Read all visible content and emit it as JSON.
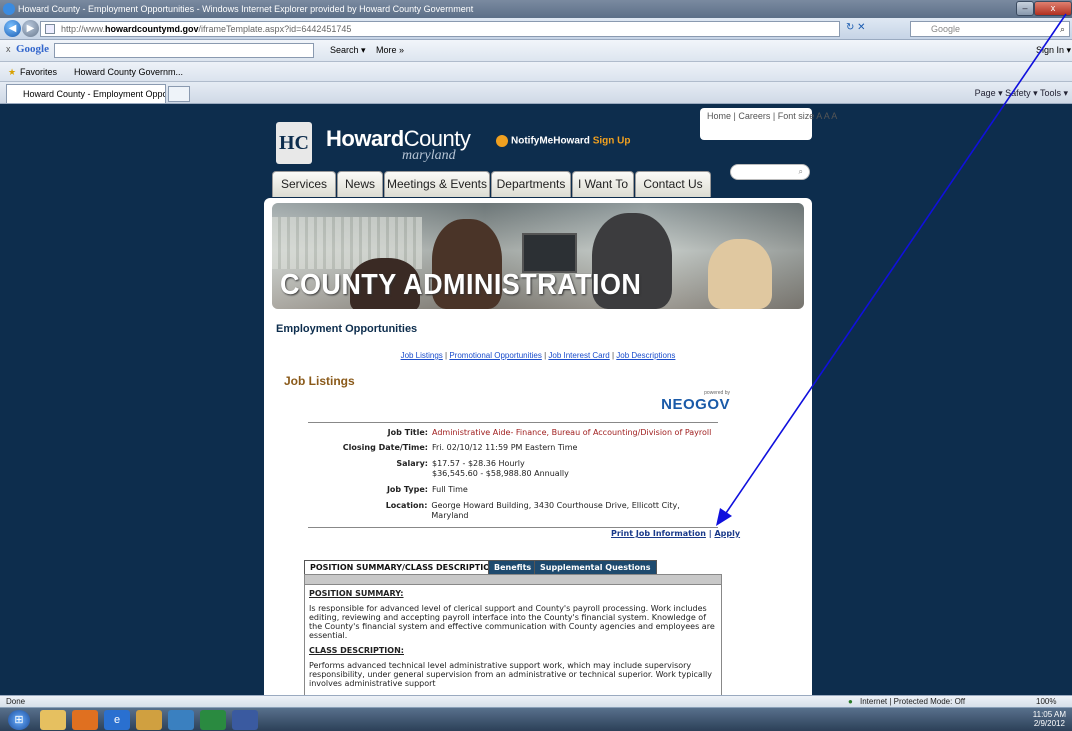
{
  "window": {
    "title": "Howard County - Employment Opportunities - Windows Internet Explorer provided by Howard County Government"
  },
  "address": {
    "url_prefix": "http://www.",
    "url_domain": "howardcountymd.gov",
    "url_path": "/iframeTemplate.aspx?id=6442451745",
    "search_placeholder": "Google"
  },
  "google_bar": {
    "x": "x",
    "logo": "Google",
    "search_label": "Search ▾",
    "more_label": "More »",
    "signin": "Sign In ▾"
  },
  "favorites": {
    "label": "Favorites",
    "item": "Howard County Governm..."
  },
  "ie_tab": {
    "label": "Howard County - Employment Opportunities"
  },
  "ie_tools": "Page ▾  Safety ▾  Tools ▾",
  "site": {
    "brand_bold": "Howard",
    "brand_rest": "County",
    "brand_sub": "maryland",
    "notify": "NotifyMeHoward",
    "signup": "Sign Up",
    "toplinks": "Home | Careers | Font size A A A",
    "nav": [
      "Services",
      "News",
      "Meetings & Events",
      "Departments",
      "I Want To",
      "Contact Us"
    ]
  },
  "banner": {
    "title": "COUNTY ADMINISTRATION"
  },
  "page": {
    "heading": "Employment Opportunities",
    "sublinks": [
      "Job Listings",
      "Promotional Opportunities",
      "Job Interest Card",
      "Job Descriptions"
    ],
    "listing_heading": "Job Listings",
    "powered_by": "powered by",
    "neogov": "NEOGOV"
  },
  "job": {
    "rows": [
      {
        "label": "Job Title:",
        "value": "Administrative Aide- Finance, Bureau of Accounting/Division of Payroll"
      },
      {
        "label": "Closing Date/Time:",
        "value": "Fri. 02/10/12 11:59 PM Eastern Time"
      },
      {
        "label": "Salary:",
        "value": "$17.57 - $28.36 Hourly",
        "value2": "$36,545.60 - $58,988.80 Annually"
      },
      {
        "label": "Job Type:",
        "value": "Full Time"
      },
      {
        "label": "Location:",
        "value": "George Howard Building, 3430 Courthouse Drive, Ellicott City, Maryland"
      }
    ],
    "print_link": "Print Job Information",
    "apply_link": "Apply"
  },
  "position": {
    "tabs": [
      "POSITION SUMMARY/CLASS DESCRIPTION",
      "Benefits",
      "Supplemental Questions"
    ],
    "summary_heading": "POSITION SUMMARY:",
    "summary_text": "Is responsible for advanced level of clerical support and County's payroll processing. Work includes editing, reviewing and accepting payroll interface into the County's financial system. Knowledge of the County's financial system and effective communication with County agencies and employees are essential.",
    "class_heading": "CLASS DESCRIPTION:",
    "class_text": "Performs advanced technical level administrative support work, which may include supervisory responsibility, under general supervision from an administrative or technical superior. Work typically involves administrative support"
  },
  "status": {
    "left": "Done",
    "zone": "Internet | Protected Mode: Off",
    "zoom": "100%"
  },
  "clock": {
    "time": "11:05 AM",
    "date": "2/9/2012"
  },
  "colors": {
    "page_bg": "#0d2d4d",
    "arrow": "#1010dd",
    "job_title": "#a02020",
    "heading_brown": "#8a5a1a"
  }
}
